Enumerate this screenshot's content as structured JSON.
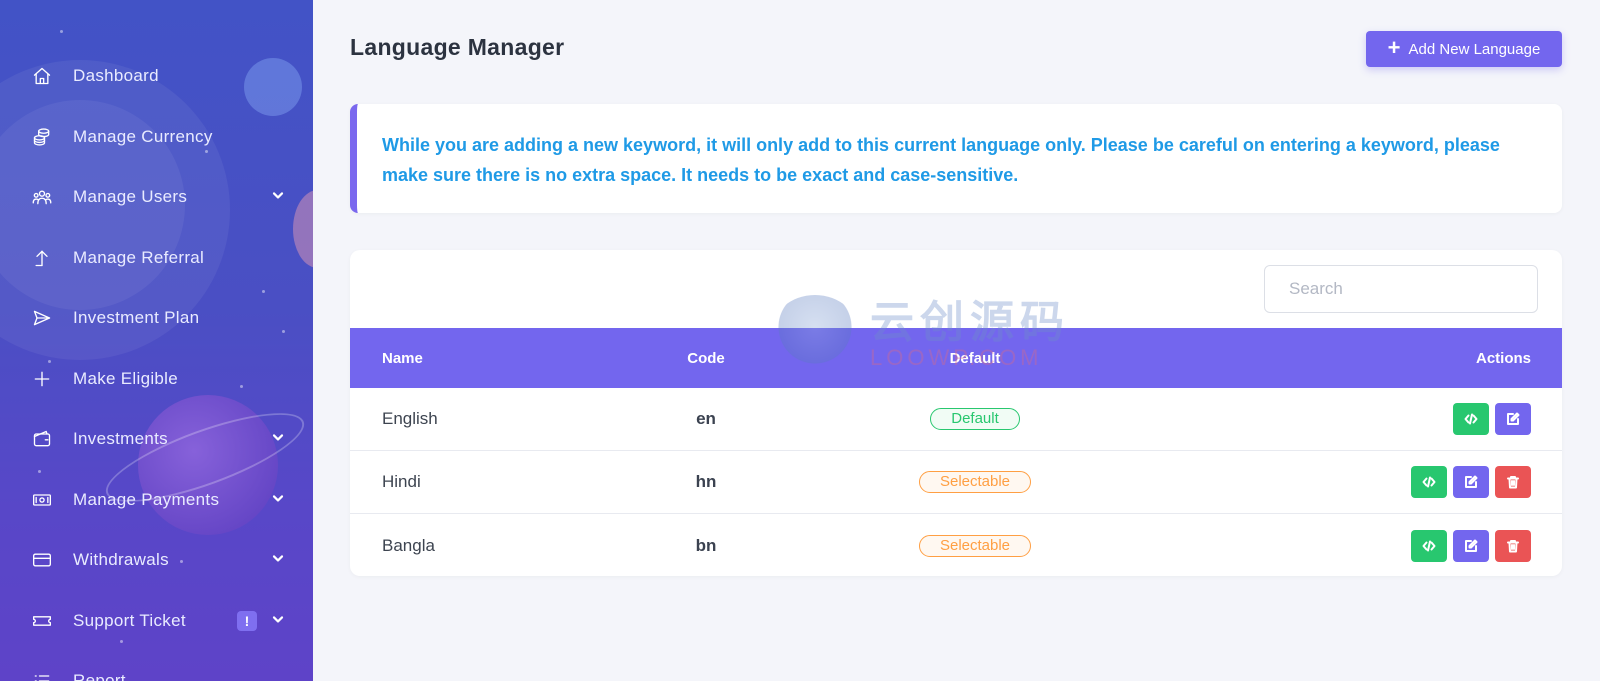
{
  "sidebar": {
    "items": [
      {
        "label": "Dashboard",
        "icon": "home-icon",
        "chevron": false
      },
      {
        "label": "Manage Currency",
        "icon": "coins-icon",
        "chevron": false
      },
      {
        "label": "Manage Users",
        "icon": "users-icon",
        "chevron": true
      },
      {
        "label": "Manage Referral",
        "icon": "arrow-up-icon",
        "chevron": false
      },
      {
        "label": "Investment Plan",
        "icon": "send-icon",
        "chevron": false
      },
      {
        "label": "Make Eligible",
        "icon": "plus-icon",
        "chevron": false
      },
      {
        "label": "Investments",
        "icon": "wallet-icon",
        "chevron": true
      },
      {
        "label": "Manage Payments",
        "icon": "money-icon",
        "chevron": true
      },
      {
        "label": "Withdrawals",
        "icon": "card-icon",
        "chevron": true
      },
      {
        "label": "Support Ticket",
        "icon": "ticket-icon",
        "chevron": true,
        "badge": "!"
      },
      {
        "label": "Report",
        "icon": "list-icon",
        "chevron": false
      }
    ]
  },
  "header": {
    "title": "Language Manager",
    "add_button_label": "Add New Language"
  },
  "notice": {
    "text": "While you are adding a new keyword, it will only add to this current language only. Please be careful on entering a keyword, please make sure there is no extra space. It needs to be exact and case-sensitive."
  },
  "search": {
    "placeholder": "Search"
  },
  "table": {
    "columns": {
      "name": "Name",
      "code": "Code",
      "default": "Default",
      "actions": "Actions"
    },
    "rows": [
      {
        "name": "English",
        "code": "en",
        "status": "Default",
        "status_type": "default",
        "deletable": false
      },
      {
        "name": "Hindi",
        "code": "hn",
        "status": "Selectable",
        "status_type": "selectable",
        "deletable": true
      },
      {
        "name": "Bangla",
        "code": "bn",
        "status": "Selectable",
        "status_type": "selectable",
        "deletable": true
      }
    ]
  },
  "watermark": {
    "main": "云创源码",
    "sub": "LOOWP.COM"
  },
  "colors": {
    "accent": "#7366ee",
    "notice_text": "#1f9ae6",
    "success": "#28c76f",
    "warning": "#ff9f43",
    "danger": "#ea5455"
  }
}
